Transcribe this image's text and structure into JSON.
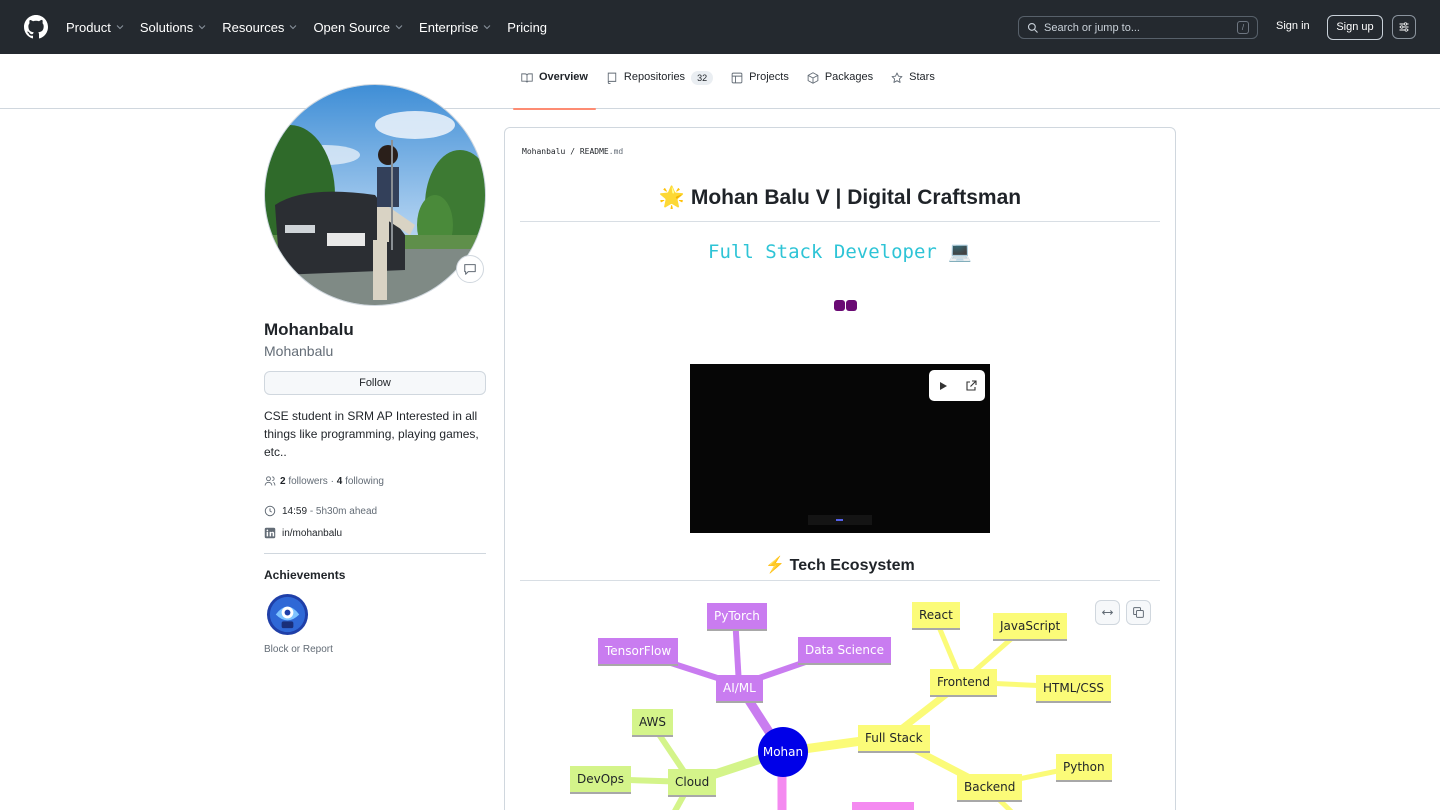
{
  "header": {
    "nav": [
      {
        "label": "Product",
        "has_menu": true
      },
      {
        "label": "Solutions",
        "has_menu": true
      },
      {
        "label": "Resources",
        "has_menu": true
      },
      {
        "label": "Open Source",
        "has_menu": true
      },
      {
        "label": "Enterprise",
        "has_menu": true
      },
      {
        "label": "Pricing",
        "has_menu": false
      }
    ],
    "search_placeholder": "Search or jump to...",
    "search_shortcut": "/",
    "sign_in": "Sign in",
    "sign_up": "Sign up"
  },
  "tabs": [
    {
      "label": "Overview",
      "icon": "book-icon",
      "active": true
    },
    {
      "label": "Repositories",
      "icon": "repo-icon",
      "count": "32"
    },
    {
      "label": "Projects",
      "icon": "table-icon"
    },
    {
      "label": "Packages",
      "icon": "package-icon"
    },
    {
      "label": "Stars",
      "icon": "star-icon"
    }
  ],
  "profile": {
    "name": "Mohanbalu",
    "login": "Mohanbalu",
    "follow_label": "Follow",
    "bio": "CSE student in SRM AP Interested in all things like programming, playing games, etc..",
    "followers_count": "2",
    "followers_label": "followers",
    "separator": "·",
    "following_count": "4",
    "following_label": "following",
    "local_time": "14:59",
    "time_offset": "- 5h30m ahead",
    "linkedin": "in/mohanbalu",
    "achievements_title": "Achievements",
    "block_report": "Block or Report"
  },
  "readme": {
    "breadcrumb_user": "Mohanbalu",
    "breadcrumb_sep": "/",
    "breadcrumb_file": "README",
    "breadcrumb_ext": ".md",
    "title": "🌟 Mohan Balu V | Digital Craftsman",
    "typing_text": "Full Stack Developer 💻",
    "section_title": "⚡ Tech Ecosystem",
    "mindmap": {
      "center": "Mohan",
      "ai_ml": {
        "label": "AI/ML",
        "children": [
          "TensorFlow",
          "PyTorch",
          "Data Science"
        ]
      },
      "full_stack": {
        "label": "Full Stack"
      },
      "frontend": {
        "label": "Frontend",
        "children": [
          "React",
          "JavaScript",
          "HTML/CSS"
        ]
      },
      "backend": {
        "label": "Backend",
        "children": [
          "Python"
        ]
      },
      "cloud": {
        "label": "Cloud",
        "children": [
          "AWS",
          "DevOps"
        ]
      }
    }
  },
  "colors": {
    "header_bg": "#24292f",
    "active_tab_underline": "#fd8c73",
    "mindmap_ai": "#c97cf0",
    "mindmap_fullstack": "#fbfb78",
    "mindmap_cloud": "#d4f48a",
    "mindmap_center": "#0000e8"
  }
}
